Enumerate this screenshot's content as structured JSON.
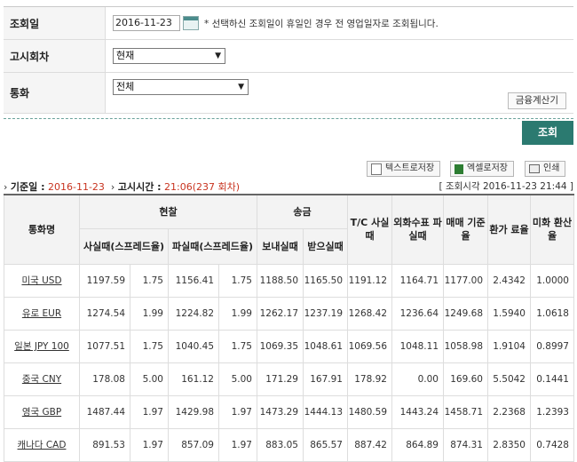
{
  "form": {
    "date_label": "조회일",
    "date_value": "2016-11-23",
    "date_note": "* 선택하신 조회일이 휴일인 경우 전 영업일자로 조회됩니다.",
    "round_label": "고시회차",
    "round_value": "현재",
    "currency_label": "통화",
    "currency_value": "전체",
    "calc_button": "금융계산기"
  },
  "query_button": "조회",
  "toolbar": {
    "text_save": "텍스트로저장",
    "excel_save": "엑셀로저장",
    "print": "인쇄"
  },
  "info": {
    "base_date_label": "기준일 :",
    "base_date": "2016-11-23",
    "notice_time_label": "고시시간 :",
    "notice_time": "21:06(237 회차)",
    "query_time": "[ 조회시각 2016-11-23 21:44 ]"
  },
  "table": {
    "headers": {
      "currency": "통화명",
      "cash": "현찰",
      "transfer": "송금",
      "cash_buy": "사실때(스프레드율)",
      "cash_sell": "파실때(스프레드율)",
      "send": "보내실때",
      "receive": "받으실때",
      "tc_buy": "T/C 사실때",
      "check_sell": "외화수표 파실때",
      "base_rate": "매매 기준율",
      "conv_rate": "환가 료율",
      "usd_rate": "미화 환산율"
    },
    "rows": [
      {
        "currency": "미국 USD",
        "cash_buy": "1197.59",
        "cash_buy_spread": "1.75",
        "cash_sell": "1156.41",
        "cash_sell_spread": "1.75",
        "send": "1188.50",
        "receive": "1165.50",
        "tc_buy": "1191.12",
        "check_sell": "1164.71",
        "base_rate": "1177.00",
        "conv_rate": "2.4342",
        "usd_rate": "1.0000"
      },
      {
        "currency": "유로 EUR",
        "cash_buy": "1274.54",
        "cash_buy_spread": "1.99",
        "cash_sell": "1224.82",
        "cash_sell_spread": "1.99",
        "send": "1262.17",
        "receive": "1237.19",
        "tc_buy": "1268.42",
        "check_sell": "1236.64",
        "base_rate": "1249.68",
        "conv_rate": "1.5940",
        "usd_rate": "1.0618"
      },
      {
        "currency": "일본 JPY 100",
        "cash_buy": "1077.51",
        "cash_buy_spread": "1.75",
        "cash_sell": "1040.45",
        "cash_sell_spread": "1.75",
        "send": "1069.35",
        "receive": "1048.61",
        "tc_buy": "1069.56",
        "check_sell": "1048.11",
        "base_rate": "1058.98",
        "conv_rate": "1.9104",
        "usd_rate": "0.8997"
      },
      {
        "currency": "중국 CNY",
        "cash_buy": "178.08",
        "cash_buy_spread": "5.00",
        "cash_sell": "161.12",
        "cash_sell_spread": "5.00",
        "send": "171.29",
        "receive": "167.91",
        "tc_buy": "178.92",
        "check_sell": "0.00",
        "base_rate": "169.60",
        "conv_rate": "5.5042",
        "usd_rate": "0.1441"
      },
      {
        "currency": "영국 GBP",
        "cash_buy": "1487.44",
        "cash_buy_spread": "1.97",
        "cash_sell": "1429.98",
        "cash_sell_spread": "1.97",
        "send": "1473.29",
        "receive": "1444.13",
        "tc_buy": "1480.59",
        "check_sell": "1443.24",
        "base_rate": "1458.71",
        "conv_rate": "2.2368",
        "usd_rate": "1.2393"
      },
      {
        "currency": "캐나다 CAD",
        "cash_buy": "891.53",
        "cash_buy_spread": "1.97",
        "cash_sell": "857.09",
        "cash_sell_spread": "1.97",
        "send": "883.05",
        "receive": "865.57",
        "tc_buy": "887.42",
        "check_sell": "864.89",
        "base_rate": "874.31",
        "conv_rate": "2.8350",
        "usd_rate": "0.7428"
      }
    ]
  }
}
